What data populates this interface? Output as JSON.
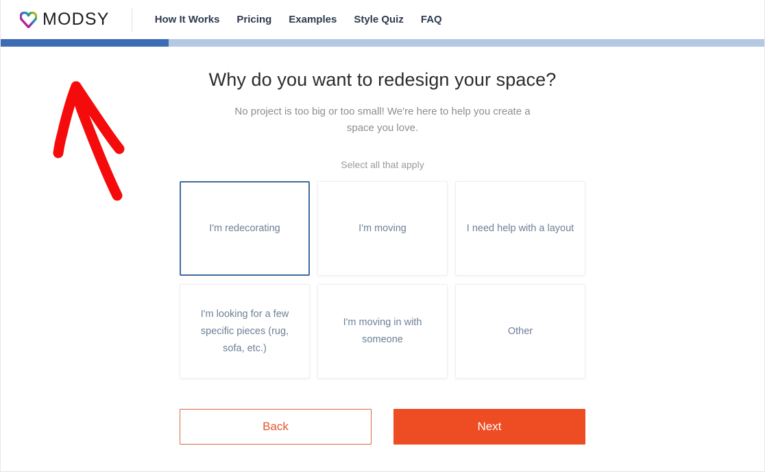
{
  "header": {
    "logo": {
      "icon": "heart-icon",
      "text": "MODSY"
    },
    "nav_items": [
      {
        "label": "How It Works"
      },
      {
        "label": "Pricing"
      },
      {
        "label": "Examples"
      },
      {
        "label": "Style Quiz"
      },
      {
        "label": "FAQ"
      }
    ]
  },
  "progress": {
    "percent": 22,
    "fill_color": "#3c6cb4",
    "track_color": "#b4c8e4"
  },
  "main": {
    "title": "Why do you want to redesign your space?",
    "subtitle": "No project is too big or too small! We're here to help you create a space you love.",
    "select_hint": "Select all that apply",
    "options": [
      {
        "label": "I'm redecorating",
        "selected": true
      },
      {
        "label": "I'm moving",
        "selected": false
      },
      {
        "label": "I need help with a layout",
        "selected": false
      },
      {
        "label": "I'm looking for a few specific pieces (rug, sofa, etc.)",
        "selected": false
      },
      {
        "label": "I'm moving in with someone",
        "selected": false
      },
      {
        "label": "Other",
        "selected": false
      }
    ]
  },
  "actions": {
    "back_label": "Back",
    "next_label": "Next"
  },
  "annotation": {
    "icon": "red-arrow-annotation",
    "color": "#f50b0b"
  },
  "colors": {
    "accent_orange": "#ee4c23",
    "selected_border": "#3d6b9e",
    "option_text": "#6d7f97",
    "nav_text": "#2d3a4e"
  }
}
